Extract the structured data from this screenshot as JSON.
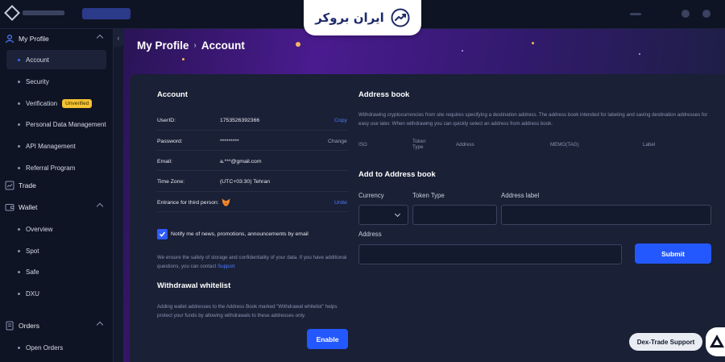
{
  "brand": {
    "watermark_text": "ایران بروکر"
  },
  "sidebar": {
    "my_profile": "My Profile",
    "items_profile": [
      {
        "label": "Account"
      },
      {
        "label": "Security"
      },
      {
        "label": "Verification",
        "badge": "Unverified"
      },
      {
        "label": "Personal Data Management"
      },
      {
        "label": "API Management"
      },
      {
        "label": "Referral Program"
      }
    ],
    "trade": "Trade",
    "wallet": "Wallet",
    "items_wallet": [
      {
        "label": "Overview"
      },
      {
        "label": "Spot"
      },
      {
        "label": "Safe"
      },
      {
        "label": "DXU"
      }
    ],
    "orders": "Orders",
    "items_orders": [
      {
        "label": "Open Orders"
      }
    ]
  },
  "breadcrumb": {
    "root": "My Profile",
    "sep": "›",
    "current": "Account"
  },
  "account": {
    "title": "Account",
    "rows": [
      {
        "label": "UserID:",
        "value": "1753526392366",
        "action": "Copy"
      },
      {
        "label": "Password:",
        "value": "*********",
        "action": "Change"
      },
      {
        "label": "Email:",
        "value": "a.***@gmail.com"
      },
      {
        "label": "Time Zone:",
        "value": "(UTC+03:30) Tehran"
      },
      {
        "label": "Entrance for third person:",
        "action": "Unite"
      }
    ],
    "notify_label": "Notify me of news, promotions, announcements by email",
    "safety_note": "We ensure the safety of storage and confidentiality of your data. If you have additional questions, you can contact",
    "support_link": "Support"
  },
  "whitelist": {
    "title": "Withdrawal whitelist",
    "note": "Adding wallet addresses to the Address Book marked \"Withdrawal whitelist\" helps protect your funds by allowing withdrawals to these addresses only.",
    "enable_label": "Enable"
  },
  "address_book": {
    "title": "Address book",
    "description": "Withdrawing cryptocurrencies from site requires specifying a destination address. The address book intended for labeling and saving destination addresses for easy use later. When withdrawing you can quickly select an address from address book.",
    "columns": [
      "ISO",
      "Token Type",
      "Address",
      "MEMO(TAG)",
      "Label"
    ]
  },
  "add_address": {
    "title": "Add to Address book",
    "currency_label": "Currency",
    "token_type_label": "Token Type",
    "address_label_label": "Address label",
    "address_label": "Address",
    "submit_label": "Submit"
  },
  "support_chat": {
    "label": "Dex-Trade Support"
  }
}
